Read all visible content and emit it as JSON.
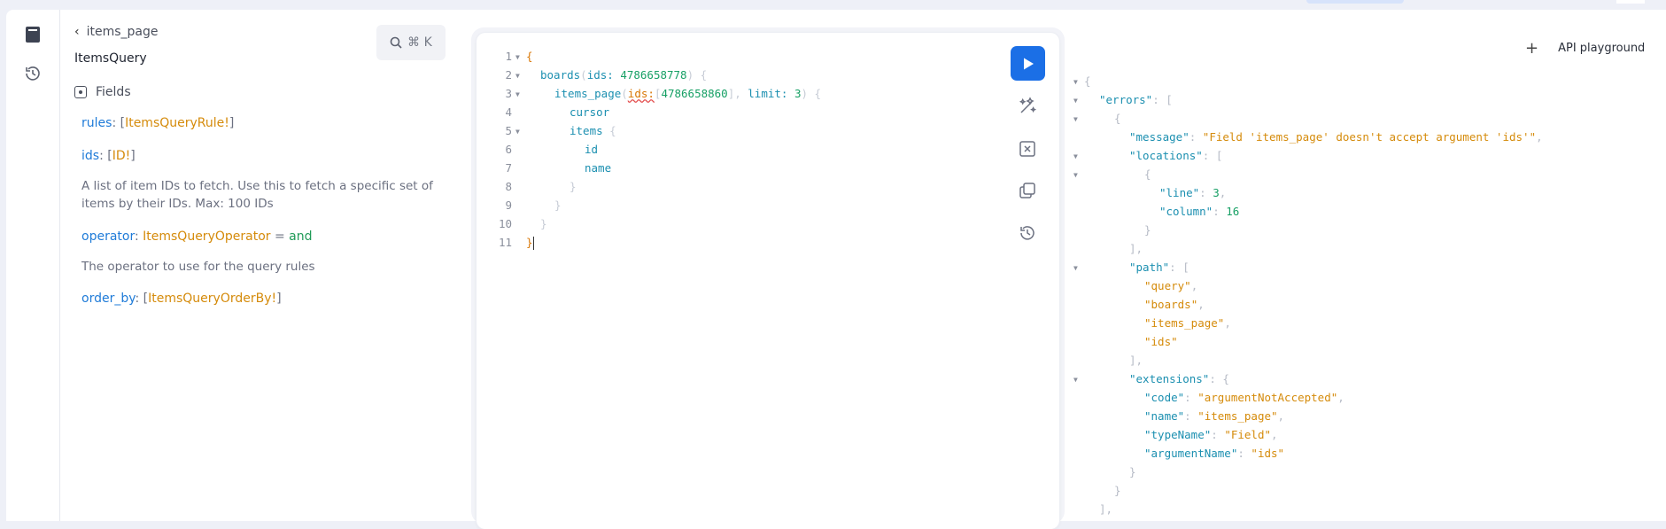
{
  "docs": {
    "back_label": "items_page",
    "title": "ItemsQuery",
    "search_shortcut": "⌘ K",
    "fields_label": "Fields",
    "fields": [
      {
        "name": "rules",
        "type": "ItemsQueryRule!"
      },
      {
        "name": "ids",
        "type": "ID!",
        "description": "A list of item IDs to fetch. Use this to fetch a specific set of items by their IDs. Max: 100 IDs"
      },
      {
        "name": "operator",
        "type": "ItemsQueryOperator",
        "default": "and",
        "description": "The operator to use for the query rules"
      },
      {
        "name": "order_by",
        "type": "ItemsQueryOrderBy!"
      }
    ]
  },
  "editor": {
    "line_numbers": [
      "1",
      "2",
      "3",
      "4",
      "5",
      "6",
      "7",
      "8",
      "9",
      "10",
      "11"
    ],
    "board_ids": "4786658778",
    "item_ids": "4786658860",
    "limit": "3"
  },
  "result": {
    "header_label": "API playground",
    "error_message": "Field 'items_page' doesn't accept argument 'ids'",
    "line": "3",
    "column": "16",
    "path": [
      "query",
      "boards",
      "items_page",
      "ids"
    ],
    "extensions": {
      "code": "argumentNotAccepted",
      "name": "items_page",
      "typeName": "Field",
      "argumentName": "ids"
    }
  },
  "colors": {
    "accent": "#1b6fe6",
    "field_name": "#1f7bd8",
    "type": "#d58b0b",
    "default_value": "#1f9a57"
  },
  "icons": [
    "docs-book-icon",
    "history-icon",
    "search-icon",
    "play-icon",
    "prettify-icon",
    "merge-fragments-icon",
    "copy-icon",
    "query-history-icon",
    "plus-icon"
  ]
}
